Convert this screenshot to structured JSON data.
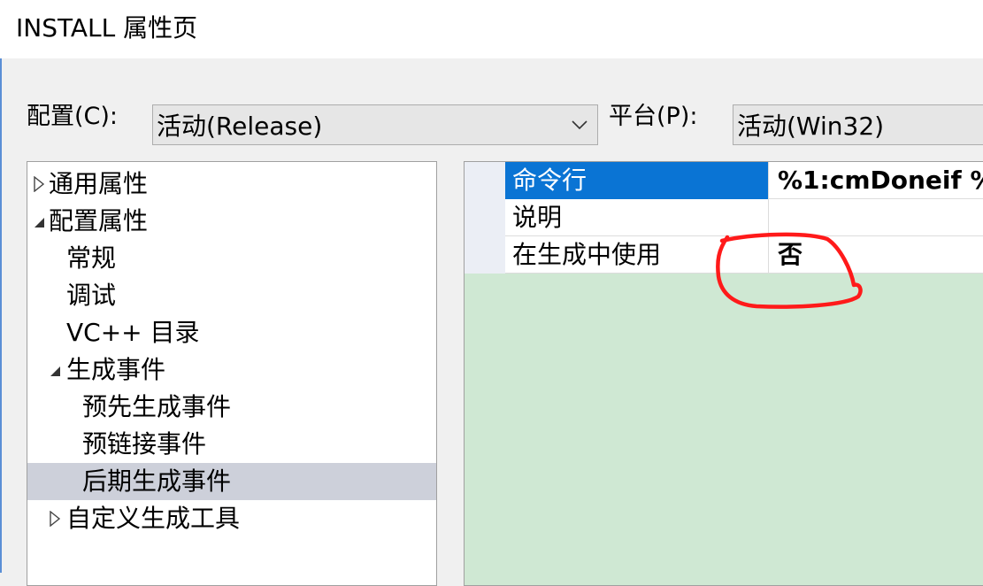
{
  "window": {
    "title": "INSTALL 属性页"
  },
  "config_bar": {
    "config_label": "配置(C):",
    "config_value": "活动(Release)",
    "platform_label": "平台(P):",
    "platform_value": "活动(Win32)"
  },
  "tree": {
    "items": [
      {
        "label": "通用属性",
        "toggle": "collapsed"
      },
      {
        "label": "配置属性",
        "toggle": "expanded"
      },
      {
        "label": "常规"
      },
      {
        "label": "调试"
      },
      {
        "label": "VC++ 目录"
      },
      {
        "label": "生成事件",
        "toggle": "expanded"
      },
      {
        "label": "预先生成事件"
      },
      {
        "label": "预链接事件"
      },
      {
        "label": "后期生成事件",
        "selected": true
      },
      {
        "label": "自定义生成工具",
        "toggle": "collapsed"
      }
    ]
  },
  "grid": {
    "rows": [
      {
        "name": "命令行",
        "value": "%1:cmDoneif %",
        "selected": true
      },
      {
        "name": "说明",
        "value": ""
      },
      {
        "name": "在生成中使用",
        "value": "否"
      }
    ]
  },
  "colors": {
    "selection_blue": "#0a74d4",
    "grid_background": "#cfe8d3",
    "tree_selection": "#cdd0da",
    "annotation_red": "#ff1a1a"
  },
  "icons": {
    "collapsed": "triangle-right-outline-icon",
    "expanded": "triangle-down-filled-icon",
    "dropdown": "chevron-down-icon"
  }
}
